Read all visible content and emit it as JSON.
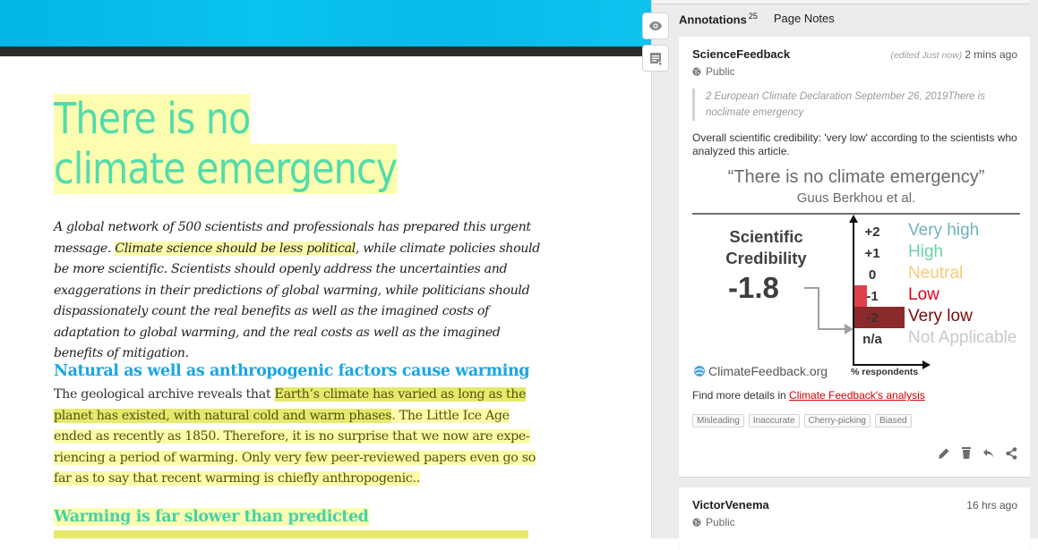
{
  "article": {
    "title_line1": "There is no",
    "title_line2": "climate emergency",
    "lead_before": "A global network of 500 scientists and professionals has prepared this urgent message. ",
    "lead_highlight": "Climate science should be less political",
    "lead_after": ", while climate policies should be more scientific. Scientists should openly address the uncertainties and exaggera­tions in their predictions of global warming, while politicians should dispassion­ately count the real benefits as well as the imagined costs of adaptation to global warming, and the real costs as well as the imagined benefits of mitigation.",
    "section1_heading": "Natural as well as anthropogenic factors cause warming",
    "section1_p1": "The geological archive reveals that ",
    "section1_hl1": "Earth’s climate has varied as long as the planet has existed, with natural cold and warm phases",
    "section1_p2": ". The Little Ice Age ended as recently as 1850. Therefore, it is no surprise that we now are expe­riencing a period of warming",
    "section1_p3": ". Only very few peer-reviewed papers even go so far as to say that recent warming is chiefly anthropogenic..",
    "section2_heading": "Warming is far slower than predicted"
  },
  "sidebar": {
    "toolbar": {
      "show_highlights": "eye-icon",
      "page_notes": "note-icon"
    },
    "tabs": [
      {
        "label": "Annotations",
        "count": "25"
      },
      {
        "label": "Page Notes"
      }
    ],
    "annotations": [
      {
        "user": "ScienceFeedback",
        "edited": "(edited Just now)",
        "time": "2 mins ago",
        "visibility": "Public",
        "quote": "2 European Climate Declaration September 26, 2019There is noclimate emergency",
        "text": "Overall scientific credibility: 'very low' according to the scient­ists who analyzed this article.",
        "image": {
          "title": "“There is no climate emergency”",
          "subtitle": "Guus Berkhou et al.",
          "credibility_label": "Scientific Credibility",
          "credibility_value": "-1.8",
          "xlabel": "% respondents",
          "logo": "ClimateFeedback.org",
          "scale": [
            {
              "tick": "+2",
              "label": "Very high",
              "color": "#6fb3bd",
              "share": 0
            },
            {
              "tick": "+1",
              "label": "High",
              "color": "#6dd3a3",
              "share": 0
            },
            {
              "tick": "0",
              "label": "Neutral",
              "color": "#fbc97f",
              "share": 0
            },
            {
              "tick": "-1",
              "label": "Low",
              "color": "#d9001b",
              "share": 0.2,
              "bar_color": "#e0404b"
            },
            {
              "tick": "-2",
              "label": "Very low",
              "color": "#7a0b0b",
              "share": 0.8,
              "bar_color": "#8b2a2a"
            },
            {
              "tick": "n/a",
              "label": "Not Applicable",
              "color": "#c9c9c9",
              "share": 0
            }
          ]
        },
        "more_prefix": "Find more details in ",
        "more_link": "Climate Feedback's analysis",
        "tags": [
          "Misleading",
          "Inaccurate",
          "Cherry-picking",
          "Biased"
        ],
        "actions": [
          "edit",
          "delete",
          "reply",
          "share"
        ]
      },
      {
        "user": "VictorVenema",
        "time": "16 hrs ago",
        "visibility": "Public"
      }
    ]
  }
}
